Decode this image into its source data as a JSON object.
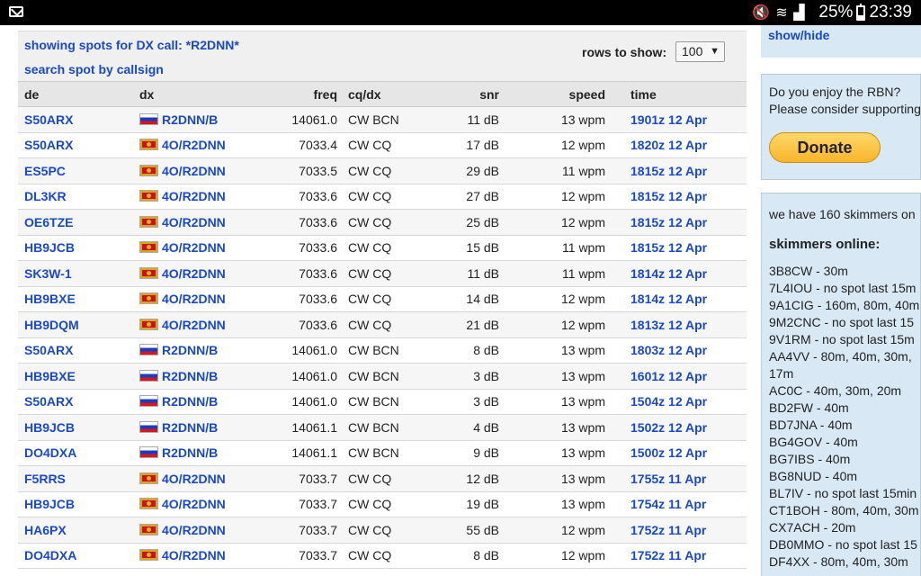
{
  "status_bar": {
    "battery": "25%",
    "time": "23:39",
    "icons": [
      "mail-icon",
      "mute-icon",
      "wifi-icon",
      "signal-icon",
      "battery-icon"
    ]
  },
  "main": {
    "showing_text": "showing spots for DX call: *R2DNN*",
    "search_link": "search spot by callsign",
    "rows_label": "rows to show:",
    "rows_value": "100"
  },
  "table": {
    "headers": [
      "de",
      "dx",
      "freq",
      "cq/dx",
      "snr",
      "speed",
      "time"
    ],
    "rows": [
      {
        "de": "S50ARX",
        "flag": "ru",
        "dx": "R2DNN/B",
        "freq": "14061.0",
        "mode": "CW BCN",
        "snr": "11 dB",
        "speed": "13 wpm",
        "time": "1901z 12 Apr"
      },
      {
        "de": "S50ARX",
        "flag": "me",
        "dx": "4O/R2DNN",
        "freq": "7033.4",
        "mode": "CW CQ",
        "snr": "17 dB",
        "speed": "12 wpm",
        "time": "1820z 12 Apr"
      },
      {
        "de": "ES5PC",
        "flag": "me",
        "dx": "4O/R2DNN",
        "freq": "7033.5",
        "mode": "CW CQ",
        "snr": "29 dB",
        "speed": "11 wpm",
        "time": "1815z 12 Apr"
      },
      {
        "de": "DL3KR",
        "flag": "me",
        "dx": "4O/R2DNN",
        "freq": "7033.6",
        "mode": "CW CQ",
        "snr": "27 dB",
        "speed": "12 wpm",
        "time": "1815z 12 Apr"
      },
      {
        "de": "OE6TZE",
        "flag": "me",
        "dx": "4O/R2DNN",
        "freq": "7033.6",
        "mode": "CW CQ",
        "snr": "25 dB",
        "speed": "12 wpm",
        "time": "1815z 12 Apr"
      },
      {
        "de": "HB9JCB",
        "flag": "me",
        "dx": "4O/R2DNN",
        "freq": "7033.6",
        "mode": "CW CQ",
        "snr": "15 dB",
        "speed": "11 wpm",
        "time": "1815z 12 Apr"
      },
      {
        "de": "SK3W-1",
        "flag": "me",
        "dx": "4O/R2DNN",
        "freq": "7033.6",
        "mode": "CW CQ",
        "snr": "11 dB",
        "speed": "11 wpm",
        "time": "1814z 12 Apr"
      },
      {
        "de": "HB9BXE",
        "flag": "me",
        "dx": "4O/R2DNN",
        "freq": "7033.6",
        "mode": "CW CQ",
        "snr": "14 dB",
        "speed": "12 wpm",
        "time": "1814z 12 Apr"
      },
      {
        "de": "HB9DQM",
        "flag": "me",
        "dx": "4O/R2DNN",
        "freq": "7033.6",
        "mode": "CW CQ",
        "snr": "21 dB",
        "speed": "12 wpm",
        "time": "1813z 12 Apr"
      },
      {
        "de": "S50ARX",
        "flag": "ru",
        "dx": "R2DNN/B",
        "freq": "14061.0",
        "mode": "CW BCN",
        "snr": "8 dB",
        "speed": "13 wpm",
        "time": "1803z 12 Apr"
      },
      {
        "de": "HB9BXE",
        "flag": "ru",
        "dx": "R2DNN/B",
        "freq": "14061.0",
        "mode": "CW BCN",
        "snr": "3 dB",
        "speed": "13 wpm",
        "time": "1601z 12 Apr"
      },
      {
        "de": "S50ARX",
        "flag": "ru",
        "dx": "R2DNN/B",
        "freq": "14061.0",
        "mode": "CW BCN",
        "snr": "3 dB",
        "speed": "13 wpm",
        "time": "1504z 12 Apr"
      },
      {
        "de": "HB9JCB",
        "flag": "ru",
        "dx": "R2DNN/B",
        "freq": "14061.1",
        "mode": "CW BCN",
        "snr": "4 dB",
        "speed": "13 wpm",
        "time": "1502z 12 Apr"
      },
      {
        "de": "DO4DXA",
        "flag": "ru",
        "dx": "R2DNN/B",
        "freq": "14061.1",
        "mode": "CW BCN",
        "snr": "9 dB",
        "speed": "13 wpm",
        "time": "1500z 12 Apr"
      },
      {
        "de": "F5RRS",
        "flag": "me",
        "dx": "4O/R2DNN",
        "freq": "7033.7",
        "mode": "CW CQ",
        "snr": "12 dB",
        "speed": "13 wpm",
        "time": "1755z 11 Apr"
      },
      {
        "de": "HB9JCB",
        "flag": "me",
        "dx": "4O/R2DNN",
        "freq": "7033.7",
        "mode": "CW CQ",
        "snr": "19 dB",
        "speed": "13 wpm",
        "time": "1754z 11 Apr"
      },
      {
        "de": "HA6PX",
        "flag": "me",
        "dx": "4O/R2DNN",
        "freq": "7033.7",
        "mode": "CW CQ",
        "snr": "55 dB",
        "speed": "12 wpm",
        "time": "1752z 11 Apr"
      },
      {
        "de": "DO4DXA",
        "flag": "me",
        "dx": "4O/R2DNN",
        "freq": "7033.7",
        "mode": "CW CQ",
        "snr": "8 dB",
        "speed": "12 wpm",
        "time": "1752z 11 Apr"
      }
    ]
  },
  "sidebar": {
    "show_hide": "show/hide",
    "donate_text_1": "Do you enjoy the RBN?",
    "donate_text_2": "Please consider supporting",
    "donate_button": "Donate",
    "skimmers_count": "we have 160 skimmers on",
    "skimmers_heading": "skimmers online:",
    "skimmers": [
      "3B8CW - 30m",
      "7L4IOU - no spot last 15m",
      "9A1CIG - 160m, 80m, 40m",
      "9M2CNC - no spot last 15",
      "9V1RM - no spot last 15m",
      "AA4VV - 80m, 40m, 30m,",
      "17m",
      "AC0C - 40m, 30m, 20m",
      "BD2FW - 40m",
      "BD7JNA - 40m",
      "BG4GOV - 40m",
      "BG7IBS - 40m",
      "BG8NUD - 40m",
      "BL7IV - no spot last 15min",
      "CT1BOH - 80m, 40m, 30m",
      "CX7ACH - 20m",
      "DB0MMO - no spot last 15",
      "DF4XX - 80m, 40m, 30m"
    ]
  }
}
